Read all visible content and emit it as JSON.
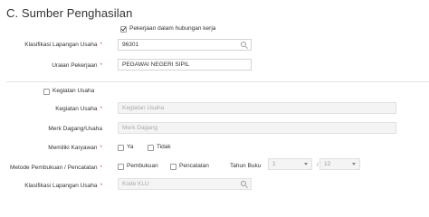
{
  "section": {
    "title": "C. Sumber Penghasilan"
  },
  "employment": {
    "checkbox_label": "Pekerjaan dalam hubungan kerja",
    "checked": true,
    "klu_label": "Klasifikasi Lapangan Usaha",
    "klu_value": "96301",
    "uraian_label": "Uraian Pekerjaan",
    "uraian_value": "PEGAWAI NEGERI SIPIL"
  },
  "business": {
    "checkbox_label": "Kegiatan Usaha",
    "checked": false,
    "kegiatan_label": "Kegiatan Usaha",
    "kegiatan_placeholder": "Kegiatan Usaha",
    "merk_label": "Merk Dagang/Usaha",
    "merk_placeholder": "Merk Dagang",
    "karyawan_label": "Memiliki Karyawan",
    "karyawan_options": [
      "Ya",
      "Tidak"
    ],
    "metode_label": "Metode Pembukuan / Pencatatan",
    "metode_options": [
      "Pembukuan",
      "Pencatatan"
    ],
    "tahun_buku_label": "Tahun Buku",
    "tahun_buku_start": "1",
    "tahun_buku_end": "12",
    "tahun_buku_separator": "/",
    "klu_label": "Klasifikasi Lapangan Usaha",
    "klu_placeholder": "Kode KLU"
  },
  "required_marker": "*",
  "colors": {
    "required": "#e05252",
    "border": "#d4d4d4",
    "disabled_bg": "#f4f4f4"
  }
}
